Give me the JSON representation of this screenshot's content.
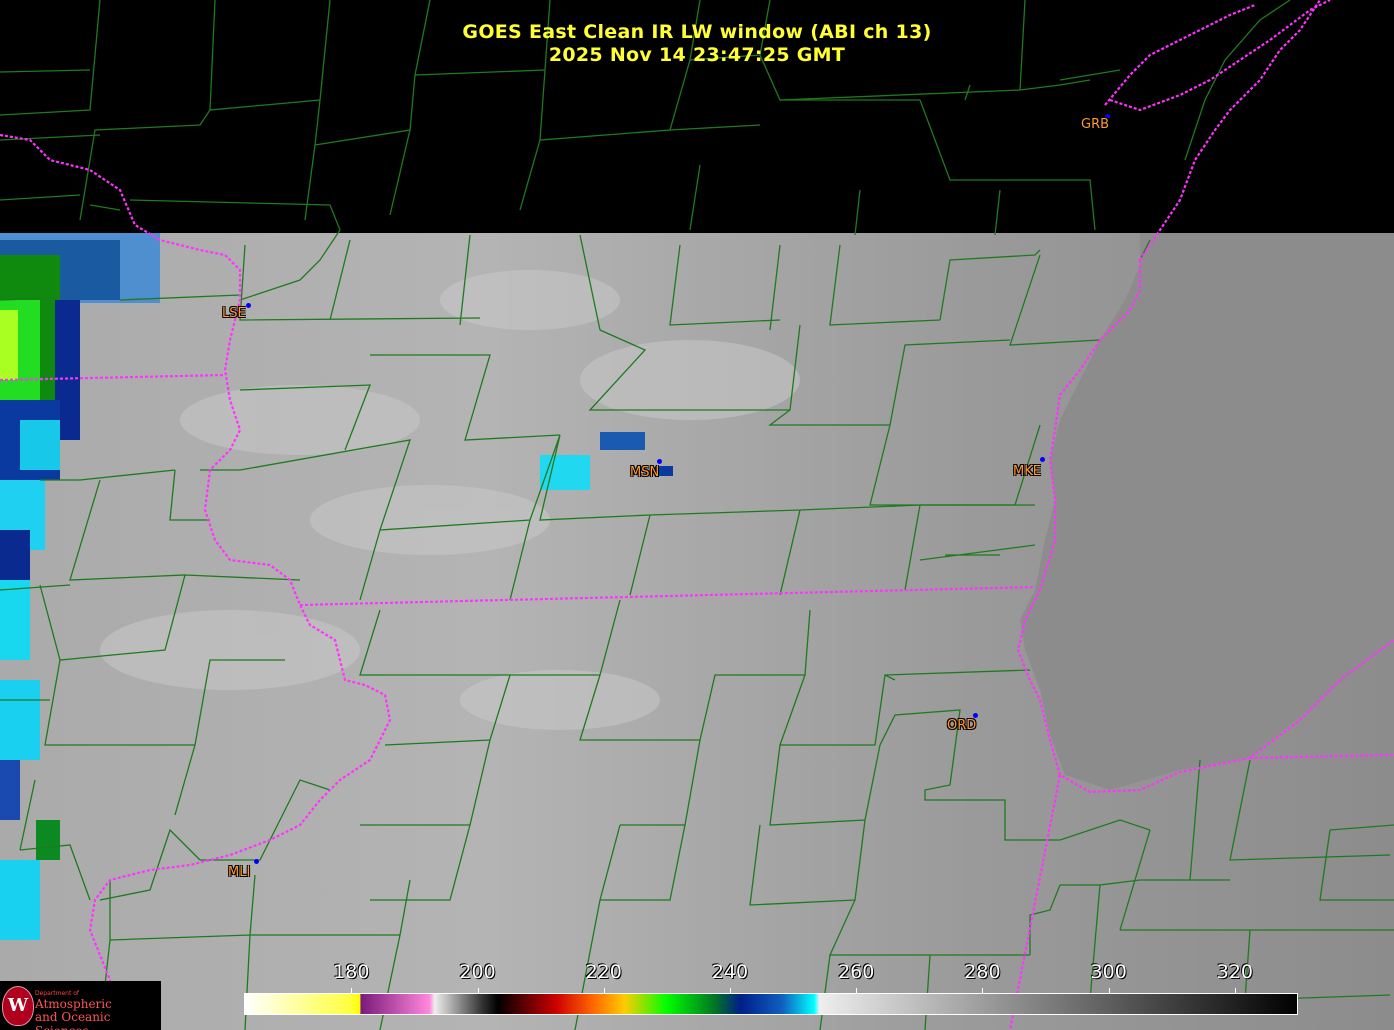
{
  "title": {
    "line1": "GOES East Clean IR LW window (ABI ch 13)",
    "line2": "2025 Nov 14  23:47:25 GMT"
  },
  "colors": {
    "title": "#ffff33",
    "county_lines": "#1f7a1f",
    "state_lines": "#ff33ff",
    "city_label": "#ff9933",
    "city_dot": "#0000ff"
  },
  "stations": [
    {
      "id": "GRB",
      "label": "GRB"
    },
    {
      "id": "LSE",
      "label": "LSE"
    },
    {
      "id": "MSN",
      "label": "MSN"
    },
    {
      "id": "MKE",
      "label": "MKE"
    },
    {
      "id": "ORD",
      "label": "ORD"
    },
    {
      "id": "MLI",
      "label": "MLI"
    }
  ],
  "colorbar": {
    "unit_note": "",
    "ticks": [
      "180",
      "200",
      "220",
      "240",
      "260",
      "280",
      "300",
      "320"
    ],
    "range": [
      163,
      330
    ]
  },
  "logo": {
    "seal": "W",
    "department": "Department of",
    "line1": "Atmospheric",
    "line2": "and Oceanic Sciences"
  }
}
